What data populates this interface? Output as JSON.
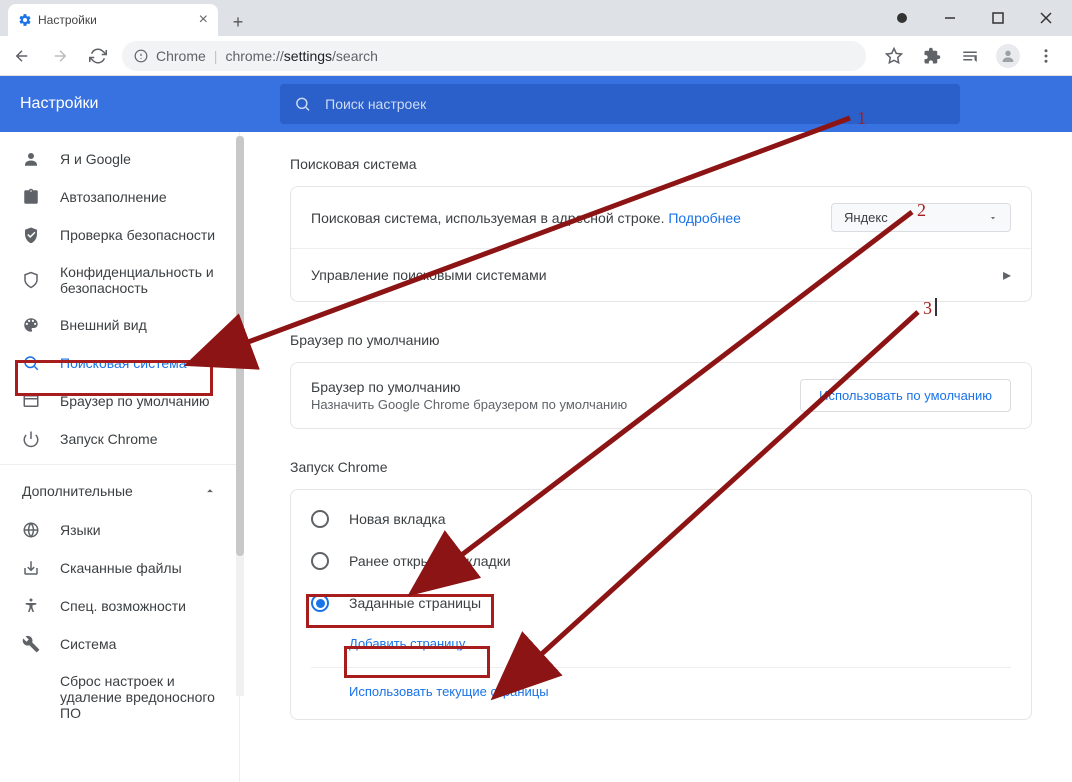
{
  "browser": {
    "tab_title": "Настройки",
    "url_label": "Chrome",
    "url_prefix": "chrome://",
    "url_bold": "settings",
    "url_rest": "/search"
  },
  "header": {
    "title": "Настройки",
    "search_placeholder": "Поиск настроек"
  },
  "sidebar": {
    "items": [
      {
        "label": "Я и Google"
      },
      {
        "label": "Автозаполнение"
      },
      {
        "label": "Проверка безопасности"
      },
      {
        "label": "Конфиденциальность и безопасность"
      },
      {
        "label": "Внешний вид"
      },
      {
        "label": "Поисковая система"
      },
      {
        "label": "Браузер по умолчанию"
      },
      {
        "label": "Запуск Chrome"
      }
    ],
    "advanced": "Дополнительные",
    "adv_items": [
      {
        "label": "Языки"
      },
      {
        "label": "Скачанные файлы"
      },
      {
        "label": "Спец. возможности"
      },
      {
        "label": "Система"
      },
      {
        "label": "Сброс настроек и удаление вредоносного ПО"
      }
    ]
  },
  "main": {
    "search_section": {
      "title": "Поисковая система",
      "row1_text": "Поисковая система, используемая в адресной строке.",
      "row1_link": "Подробнее",
      "dropdown_value": "Яндекс",
      "row2_text": "Управление поисковыми системами"
    },
    "default_section": {
      "title": "Браузер по умолчанию",
      "row_title": "Браузер по умолчанию",
      "row_sub": "Назначить Google Chrome браузером по умолчанию",
      "button": "Использовать по умолчанию"
    },
    "startup_section": {
      "title": "Запуск Chrome",
      "opt1": "Новая вкладка",
      "opt2": "Ранее открытые вкладки",
      "opt3": "Заданные страницы",
      "link1": "Добавить страницу",
      "link2": "Использовать текущие страницы"
    }
  },
  "annotations": {
    "n1": "1",
    "n2": "2",
    "n3": "3"
  }
}
